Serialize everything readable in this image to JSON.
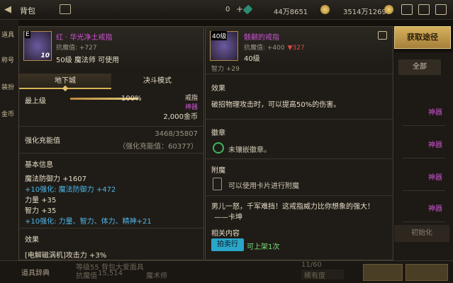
{
  "topbar": {
    "title": "背包",
    "currency0": "0",
    "currency1": "44万8651",
    "currency2": "3514万1269"
  },
  "bag": {
    "left_tabs": [
      "道具",
      "称号",
      "装扮",
      "金币"
    ],
    "filter_all": "全部",
    "slot_labels": [
      "神器",
      "神器",
      "神器",
      "神器"
    ],
    "init_button": "初始化",
    "dict_label": "道具辞典",
    "bottom_level": "等级55 背包大爱面具",
    "bottom_resist_label": "抗魔值",
    "bottom_resist_value": "15,514",
    "bottom_class": "魔术师",
    "bottom_capacity": "11/60",
    "bottom_rarity": "稀有度"
  },
  "left_item": {
    "badge": "E",
    "level_tag": "10",
    "name": "红 · 华光净土戒指",
    "resist": "抗魔值: +727",
    "requirement": "50级 魔法师 可使用",
    "tabs": [
      "地下城",
      "决斗模式"
    ],
    "upgrade_label": "最上级",
    "upgrade_percent": 1.0,
    "upgrade_percent_text": "100%",
    "slot_type": "戒指",
    "rarity": "神器",
    "price": "2,000金币",
    "charge_label": "强化充能值",
    "charge_value": "3468/35807",
    "charge_sub": "（强化充能值：60377）",
    "basic_info_title": "基本信息",
    "stats": [
      {
        "text": "魔法防御力 +1607",
        "color": "white"
      },
      {
        "text": "+10强化: 魔法防御力 +472",
        "color": "blue"
      },
      {
        "text": "力量 +35",
        "color": "white"
      },
      {
        "text": "智力 +35",
        "color": "white"
      },
      {
        "text": "+10强化: 力量、智力、体力、精神+21",
        "color": "blue"
      }
    ],
    "effect_title": "效果",
    "effect_line": "[电解磁涡机]攻击力 +3%"
  },
  "right_item": {
    "badge": "40级",
    "name": "骸颡的戒指",
    "resist_value": "抗魔值: +400",
    "resist_diff": "▼327",
    "level": "40级",
    "cut_line": "智力 +29",
    "effect_title": "效果",
    "effect_text": "破招物理攻击时，可以提高50%的伤害。",
    "emblem_title": "徽章",
    "emblem_text": "未镶嵌徽章。",
    "enchant_title": "附魔",
    "enchant_text": "可以使用卡片进行附魔",
    "quote": "男儿一怒，千军难挡！这戒指威力比你想象的强大！",
    "quote_author": "——卡坤",
    "related_title": "相关内容",
    "auction_button": "拍卖行",
    "listed_text": "可上架1次"
  },
  "get_path_button": "获取途径",
  "colors": {
    "epic": "#d152d8",
    "enhance": "#4fb6ea",
    "down": "#e24a4a",
    "gold": "#d6b15c"
  }
}
